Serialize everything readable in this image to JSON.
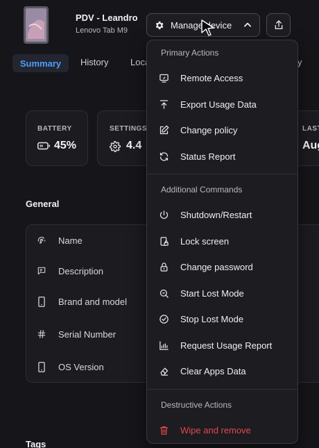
{
  "header": {
    "device_name": "PDV - Leandro",
    "device_model": "Lenovo Tab M9",
    "manage_label": "Manage device"
  },
  "tabs": [
    {
      "label": "Summary",
      "active": true
    },
    {
      "label": "History"
    },
    {
      "label": "Loca"
    },
    {
      "label": "y"
    }
  ],
  "stats": {
    "battery": {
      "label": "BATTERY",
      "value": "45%"
    },
    "settings": {
      "label": "SETTINGS",
      "value": "4.4"
    },
    "last": {
      "label": "LAST",
      "value": "Aug"
    }
  },
  "general": {
    "title": "General",
    "rows": [
      {
        "label": "Name",
        "icon": "fingerprint-icon"
      },
      {
        "label": "Description",
        "icon": "message-square-icon"
      },
      {
        "label": "Brand and model",
        "icon": "tablet-icon"
      },
      {
        "label": "Serial Number",
        "icon": "hash-icon"
      },
      {
        "label": "OS Version",
        "icon": "tablet-icon"
      }
    ]
  },
  "tags_title": "Tags",
  "menu": {
    "primary_heading": "Primary Actions",
    "primary": [
      {
        "label": "Remote Access",
        "icon": "screen-share-icon"
      },
      {
        "label": "Export Usage Data",
        "icon": "upload-icon"
      },
      {
        "label": "Change policy",
        "icon": "edit-icon"
      },
      {
        "label": "Status Report",
        "icon": "refresh-icon"
      }
    ],
    "additional_heading": "Additional Commands",
    "additional": [
      {
        "label": "Shutdown/Restart",
        "icon": "power-icon"
      },
      {
        "label": "Lock screen",
        "icon": "phone-lock-icon"
      },
      {
        "label": "Change password",
        "icon": "lock-icon"
      },
      {
        "label": "Start Lost Mode",
        "icon": "search-icon"
      },
      {
        "label": "Stop Lost Mode",
        "icon": "check-circle-icon"
      },
      {
        "label": "Request Usage Report",
        "icon": "bar-chart-icon"
      },
      {
        "label": "Clear Apps Data",
        "icon": "eraser-icon"
      }
    ],
    "destructive_heading": "Destructive Actions",
    "destructive": [
      {
        "label": "Wipe and remove",
        "icon": "trash-icon",
        "color": "#e5484d"
      }
    ]
  },
  "colors": {
    "accent": "#4f9cf7",
    "danger": "#e5484d",
    "background": "#16161a"
  }
}
